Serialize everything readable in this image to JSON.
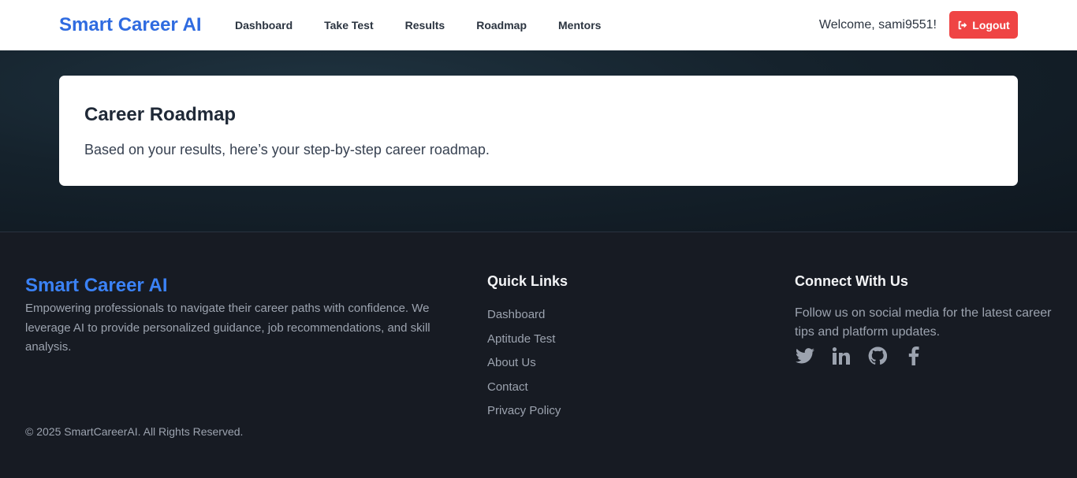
{
  "nav": {
    "brand": "Smart Career AI",
    "links": [
      "Dashboard",
      "Take Test",
      "Results",
      "Roadmap",
      "Mentors"
    ],
    "welcome": "Welcome, sami9551!",
    "logout_label": "Logout"
  },
  "card": {
    "title": "Career Roadmap",
    "subtitle": "Based on your results, here’s your step-by-step career roadmap."
  },
  "footer": {
    "brand": "Smart Career AI",
    "description": "Empowering professionals to navigate their career paths with confidence. We leverage AI to provide personalized guidance, job recommendations, and skill analysis.",
    "copyright": "© 2025 SmartCareerAI. All Rights Reserved.",
    "quick_links_title": "Quick Links",
    "quick_links": [
      "Dashboard",
      "Aptitude Test",
      "About Us",
      "Contact",
      "Privacy Policy"
    ],
    "connect_title": "Connect With Us",
    "connect_desc": "Follow us on social media for the latest career tips and platform updates.",
    "socials": [
      "twitter-icon",
      "linkedin-icon",
      "github-icon",
      "facebook-icon"
    ]
  },
  "colors": {
    "brand": "#2f6be0",
    "logout": "#ef4444",
    "footer_bg": "#171b23"
  }
}
